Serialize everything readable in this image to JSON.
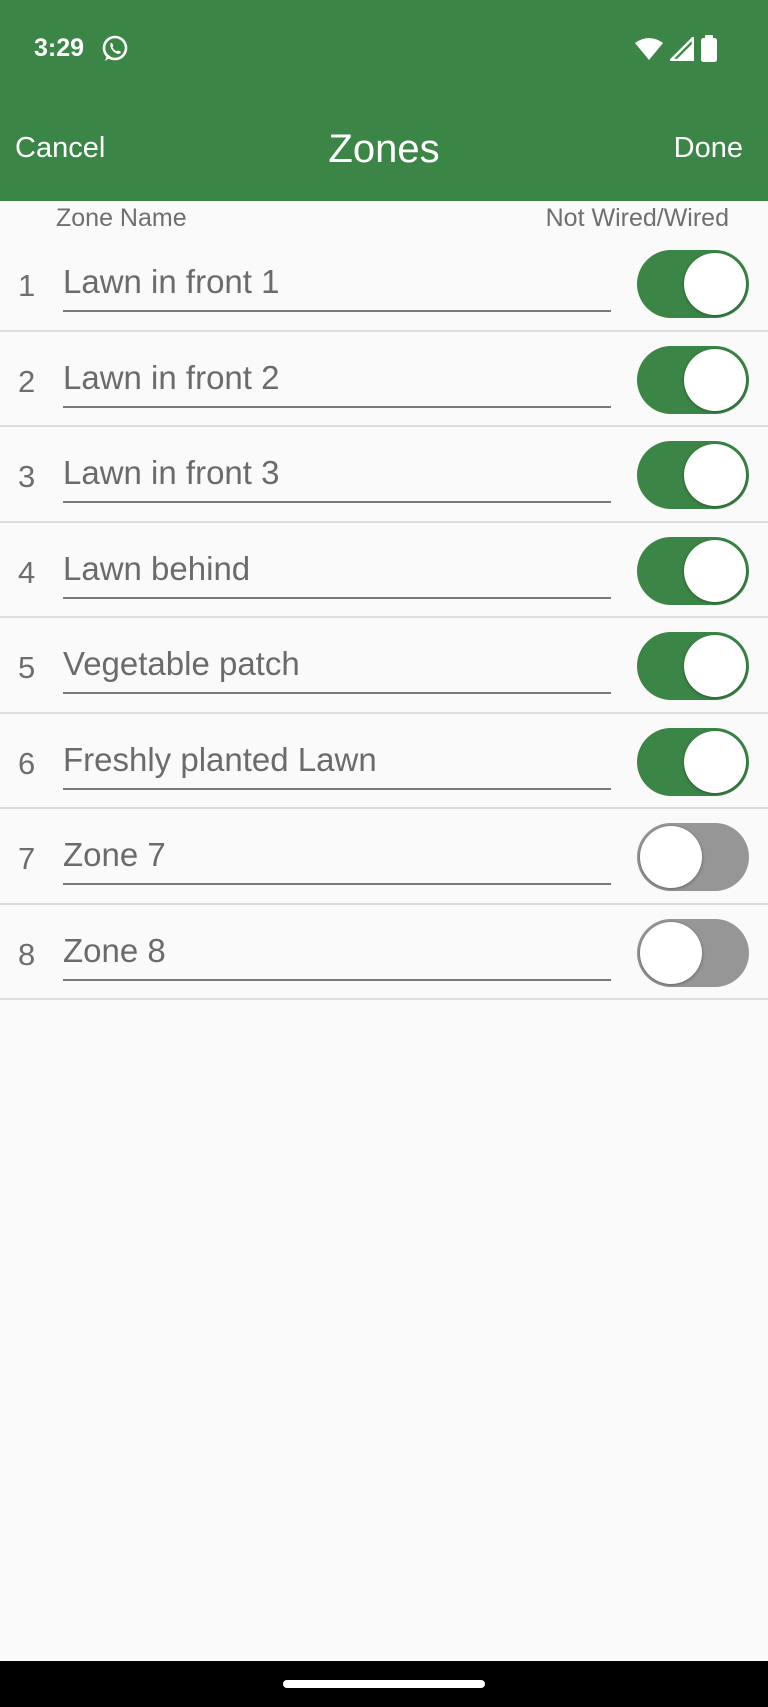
{
  "status_bar": {
    "time": "3:29",
    "icons": [
      "whatsapp-icon",
      "wifi-icon",
      "signal-icon",
      "battery-icon"
    ]
  },
  "nav": {
    "cancel_label": "Cancel",
    "title": "Zones",
    "done_label": "Done"
  },
  "columns": {
    "zone_name": "Zone Name",
    "wired": "Not Wired/Wired"
  },
  "zones": [
    {
      "number": "1",
      "name": "Lawn in front 1",
      "wired": true
    },
    {
      "number": "2",
      "name": "Lawn in front 2",
      "wired": true
    },
    {
      "number": "3",
      "name": "Lawn in front 3",
      "wired": true
    },
    {
      "number": "4",
      "name": "Lawn behind",
      "wired": true
    },
    {
      "number": "5",
      "name": "Vegetable patch",
      "wired": true
    },
    {
      "number": "6",
      "name": "Freshly planted Lawn",
      "wired": true
    },
    {
      "number": "7",
      "name": "Zone 7",
      "wired": false
    },
    {
      "number": "8",
      "name": "Zone 8",
      "wired": false
    }
  ],
  "colors": {
    "accent": "#3b8546",
    "toggle_off": "#969696",
    "background": "#fafafa"
  }
}
